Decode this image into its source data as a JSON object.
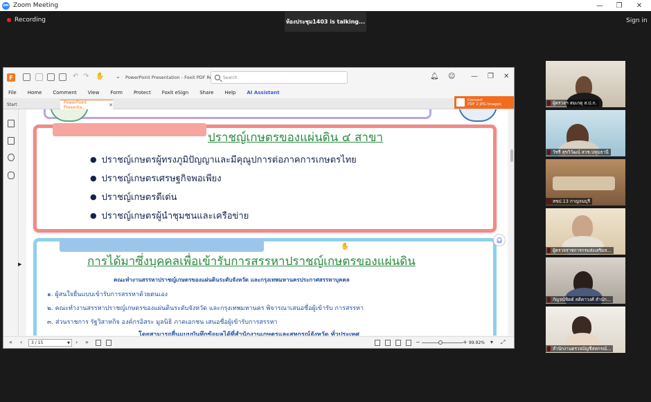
{
  "window": {
    "title": "Zoom Meeting",
    "controls": {
      "minimize": "—",
      "restore": "❐",
      "close": "✕"
    }
  },
  "meeting": {
    "recording_label": "Recording",
    "talking_indicator": "ห้องประชุม1403 is talking...",
    "signin_label": "Sign in"
  },
  "foxit": {
    "app_title": "PowerPoint Presentation - Foxit PDF Rea...",
    "search_placeholder": "Search",
    "menu": [
      "File",
      "Home",
      "Comment",
      "View",
      "Form",
      "Protect",
      "Foxit eSign",
      "Share",
      "Help",
      "AI Assistant"
    ],
    "tabs": {
      "start": "Start",
      "active": "PowerPoint Presenta..."
    },
    "convert": {
      "line1": "Convert",
      "line2": "PDF 2 JPG Images"
    },
    "status": {
      "page": "3 / 15",
      "zoom": "99.92%"
    }
  },
  "slide": {
    "section1": {
      "heading": "ปราชญ์เกษตรของแผ่นดิน ๔ สาขา",
      "bullets": [
        "ปราชญ์เกษตรผู้ทรงภูมิปัญญาและมีคุณูปการต่อภาคการเกษตรไทย",
        "ปราชญ์เกษตรเศรษฐกิจพอเพียง",
        "ปราชญ์เกษตรดีเด่น",
        "ปราชญ์เกษตรผู้นำชุมชนและเครือข่าย"
      ]
    },
    "section2": {
      "heading": "การได้มาซึ่งบุคคลเพื่อเข้ารับการสรรหาปราชญ์เกษตรของแผ่นดิน",
      "subheading": "คณะทำงานสรรหาปราชญ์เกษตรของแผ่นดินระดับจังหวัด และกรุงเทพมหานครประกาศสรรหาบุคคล",
      "items": [
        "๑. ผู้สนใจยื่นแบบเข้ารับการสรรหาด้วยตนเอง",
        "๒. คณะทำงานสรรหาปราชญ์เกษตรของแผ่นดินระดับจังหวัด และกรุงเทพมหานคร พิจารณาเสนอชื่อผู้เข้ารับ การสรรหา",
        "๓. ส่วนราชการ รัฐวิสาหกิจ องค์กรอิสระ มูลนิธิ ภาคเอกชน เสนอชื่อผู้เข้ารับการสรรหา"
      ],
      "cutoff_line": "โดยสามารถยื่นแบบบันทึกข้อมูลได้ที่สำนักงานเกษตรและสหกรณ์จังหวัด ทั่วประเทศ"
    }
  },
  "participants": [
    "ผู้ตรวจฯ สมเกตุ ส.ป.ก.",
    "วัชรี สุขวิวัฒน์ สวช.ปทุมธานี",
    "สขป.13 กาญจนบุรี",
    "ผู้ตรวจราชการกรมส่งเสริมส...",
    "กัญจน์ชิตต์ ลดิคาวงศ์ สำนัก...",
    "สำนักงานตรวจบัญชีสหกรณ์..."
  ],
  "colors": {
    "zoom_bg": "#1a1a1a",
    "foxit_accent": "#f47a20",
    "slide_red_border": "#f08a86",
    "slide_blue_border": "#8fd0ea",
    "heading_green": "#2a8b3f",
    "text_blue": "#1f4e9c"
  }
}
